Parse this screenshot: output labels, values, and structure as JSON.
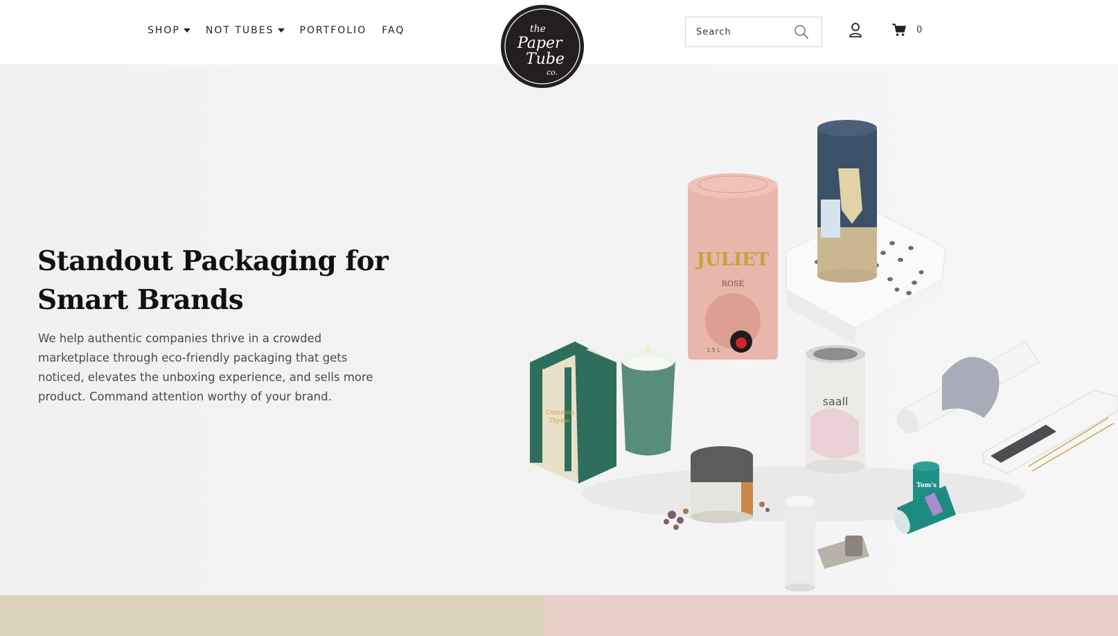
{
  "brand": {
    "logo_text_top": "the",
    "logo_text_mid": "Paper",
    "logo_text_bot": "Tube",
    "logo_text_co": "co."
  },
  "nav": {
    "items": [
      {
        "label": "SHOP",
        "has_caret": true
      },
      {
        "label": "NOT TUBES",
        "has_caret": true
      },
      {
        "label": "PORTFOLIO",
        "has_caret": false
      },
      {
        "label": "FAQ",
        "has_caret": false
      }
    ]
  },
  "search": {
    "placeholder": "Search"
  },
  "cart": {
    "count": "0"
  },
  "hero": {
    "title_line1": "Standout Packaging for",
    "title_line2": "Smart Brands",
    "description": "We help authentic companies thrive in a crowded marketplace through eco-friendly packaging that gets noticed, elevates the unboxing experience, and sells more product. Command attention worthy of your brand.",
    "image_labels": {
      "juliet": "JULIET",
      "rose": "ROSÉ",
      "volume": "1.5 L",
      "saall": "saall",
      "toms": "Tom's"
    }
  },
  "colors": {
    "hero_bg": "#f2f2f3",
    "strip_left": "#dbd3ba",
    "strip_right": "#e8d0c8",
    "logo_bg": "#231f20"
  }
}
